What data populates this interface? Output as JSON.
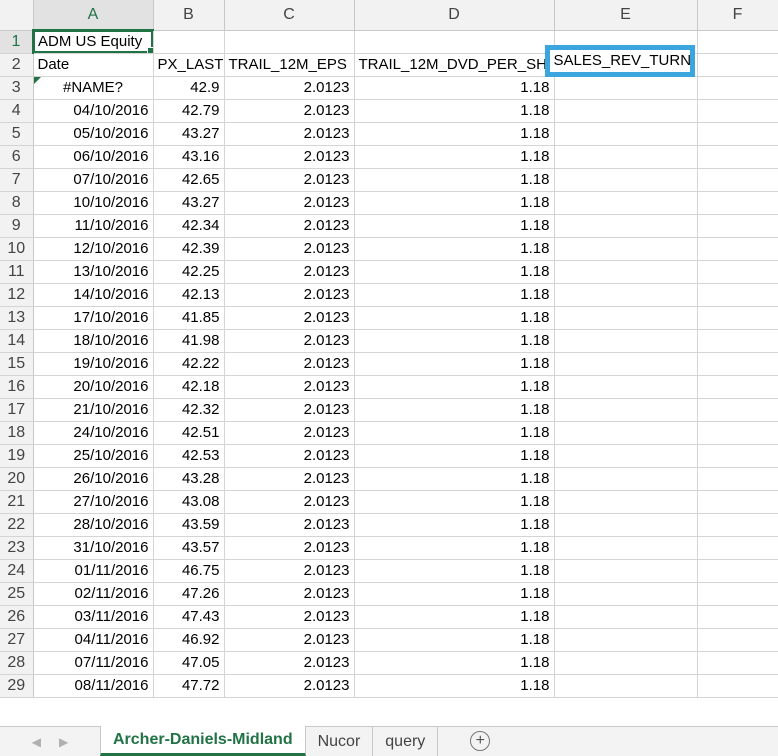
{
  "columns": [
    "A",
    "B",
    "C",
    "D",
    "E",
    "F"
  ],
  "row1": {
    "num": "1",
    "a": "ADM US Equity"
  },
  "row2": {
    "num": "2",
    "a": "Date",
    "b": "PX_LAST",
    "c": "TRAIL_12M_EPS",
    "d": "TRAIL_12M_DVD_PER_SH",
    "e": "SALES_REV_TURN"
  },
  "rows": [
    {
      "num": "3",
      "a": "#NAME?",
      "b": "42.9",
      "c": "2.0123",
      "d": "1.18"
    },
    {
      "num": "4",
      "a": "04/10/2016",
      "b": "42.79",
      "c": "2.0123",
      "d": "1.18"
    },
    {
      "num": "5",
      "a": "05/10/2016",
      "b": "43.27",
      "c": "2.0123",
      "d": "1.18"
    },
    {
      "num": "6",
      "a": "06/10/2016",
      "b": "43.16",
      "c": "2.0123",
      "d": "1.18"
    },
    {
      "num": "7",
      "a": "07/10/2016",
      "b": "42.65",
      "c": "2.0123",
      "d": "1.18"
    },
    {
      "num": "8",
      "a": "10/10/2016",
      "b": "43.27",
      "c": "2.0123",
      "d": "1.18"
    },
    {
      "num": "9",
      "a": "11/10/2016",
      "b": "42.34",
      "c": "2.0123",
      "d": "1.18"
    },
    {
      "num": "10",
      "a": "12/10/2016",
      "b": "42.39",
      "c": "2.0123",
      "d": "1.18"
    },
    {
      "num": "11",
      "a": "13/10/2016",
      "b": "42.25",
      "c": "2.0123",
      "d": "1.18"
    },
    {
      "num": "12",
      "a": "14/10/2016",
      "b": "42.13",
      "c": "2.0123",
      "d": "1.18"
    },
    {
      "num": "13",
      "a": "17/10/2016",
      "b": "41.85",
      "c": "2.0123",
      "d": "1.18"
    },
    {
      "num": "14",
      "a": "18/10/2016",
      "b": "41.98",
      "c": "2.0123",
      "d": "1.18"
    },
    {
      "num": "15",
      "a": "19/10/2016",
      "b": "42.22",
      "c": "2.0123",
      "d": "1.18"
    },
    {
      "num": "16",
      "a": "20/10/2016",
      "b": "42.18",
      "c": "2.0123",
      "d": "1.18"
    },
    {
      "num": "17",
      "a": "21/10/2016",
      "b": "42.32",
      "c": "2.0123",
      "d": "1.18"
    },
    {
      "num": "18",
      "a": "24/10/2016",
      "b": "42.51",
      "c": "2.0123",
      "d": "1.18"
    },
    {
      "num": "19",
      "a": "25/10/2016",
      "b": "42.53",
      "c": "2.0123",
      "d": "1.18"
    },
    {
      "num": "20",
      "a": "26/10/2016",
      "b": "43.28",
      "c": "2.0123",
      "d": "1.18"
    },
    {
      "num": "21",
      "a": "27/10/2016",
      "b": "43.08",
      "c": "2.0123",
      "d": "1.18"
    },
    {
      "num": "22",
      "a": "28/10/2016",
      "b": "43.59",
      "c": "2.0123",
      "d": "1.18"
    },
    {
      "num": "23",
      "a": "31/10/2016",
      "b": "43.57",
      "c": "2.0123",
      "d": "1.18"
    },
    {
      "num": "24",
      "a": "01/11/2016",
      "b": "46.75",
      "c": "2.0123",
      "d": "1.18"
    },
    {
      "num": "25",
      "a": "02/11/2016",
      "b": "47.26",
      "c": "2.0123",
      "d": "1.18"
    },
    {
      "num": "26",
      "a": "03/11/2016",
      "b": "47.43",
      "c": "2.0123",
      "d": "1.18"
    },
    {
      "num": "27",
      "a": "04/11/2016",
      "b": "46.92",
      "c": "2.0123",
      "d": "1.18"
    },
    {
      "num": "28",
      "a": "07/11/2016",
      "b": "47.05",
      "c": "2.0123",
      "d": "1.18"
    },
    {
      "num": "29",
      "a": "08/11/2016",
      "b": "47.72",
      "c": "2.0123",
      "d": "1.18"
    }
  ],
  "sheets": {
    "active": "Archer-Daniels-Midland",
    "others": [
      "Nucor",
      "query"
    ],
    "add_icon": "plus-circle-icon"
  },
  "colors": {
    "accent": "#217346",
    "highlight_border": "#3aa6dd"
  }
}
